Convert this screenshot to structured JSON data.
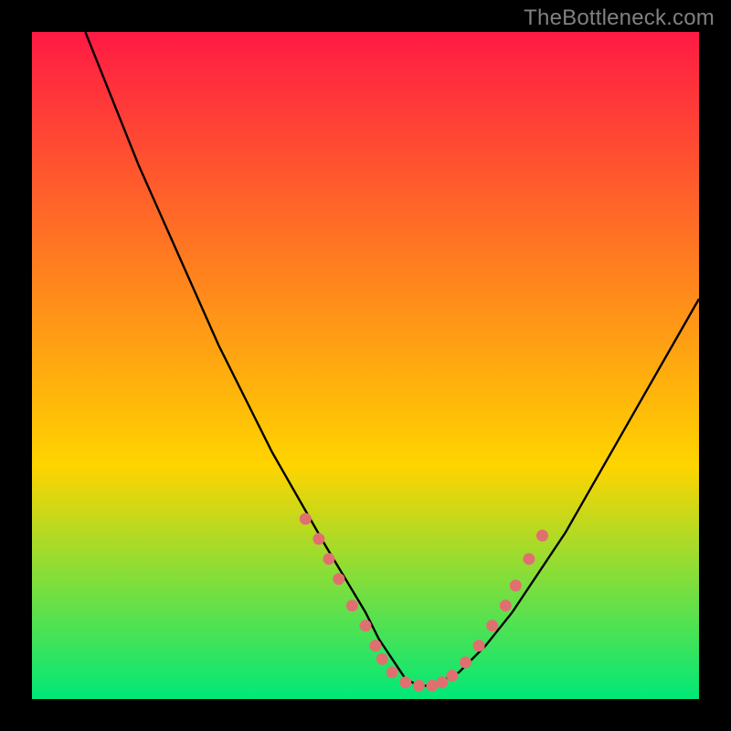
{
  "watermark": {
    "text": "TheBottleneck.com"
  },
  "colors": {
    "frame_bg": "#000000",
    "gradient_top": "#ff1a44",
    "gradient_mid": "#ffd400",
    "gradient_bottom": "#00e878",
    "curve": "#000000",
    "dots": "#e07070"
  },
  "chart_data": {
    "type": "line",
    "title": "",
    "xlabel": "",
    "ylabel": "",
    "xlim": [
      0,
      100
    ],
    "ylim": [
      0,
      100
    ],
    "grid": false,
    "series": [
      {
        "name": "bottleneck_curve",
        "x": [
          8,
          12,
          16,
          20,
          24,
          28,
          32,
          36,
          40,
          44,
          47,
          50,
          52,
          54,
          56,
          58,
          60,
          64,
          68,
          72,
          76,
          80,
          84,
          88,
          92,
          96,
          100
        ],
        "y": [
          100,
          90,
          80,
          71,
          62,
          53,
          45,
          37,
          30,
          23,
          18,
          13,
          9,
          6,
          3,
          2,
          2,
          4,
          8,
          13,
          19,
          25,
          32,
          39,
          46,
          53,
          60
        ]
      }
    ],
    "annotations": {
      "highlight_dots": [
        {
          "x": 41,
          "y": 27
        },
        {
          "x": 43,
          "y": 24
        },
        {
          "x": 44.5,
          "y": 21
        },
        {
          "x": 46,
          "y": 18
        },
        {
          "x": 48,
          "y": 14
        },
        {
          "x": 50,
          "y": 11
        },
        {
          "x": 51.5,
          "y": 8
        },
        {
          "x": 52.5,
          "y": 6
        },
        {
          "x": 54,
          "y": 4
        },
        {
          "x": 56,
          "y": 2.5
        },
        {
          "x": 58,
          "y": 2
        },
        {
          "x": 60,
          "y": 2
        },
        {
          "x": 61.5,
          "y": 2.5
        },
        {
          "x": 63,
          "y": 3.5
        },
        {
          "x": 65,
          "y": 5.5
        },
        {
          "x": 67,
          "y": 8
        },
        {
          "x": 69,
          "y": 11
        },
        {
          "x": 71,
          "y": 14
        },
        {
          "x": 72.5,
          "y": 17
        },
        {
          "x": 74.5,
          "y": 21
        },
        {
          "x": 76.5,
          "y": 24.5
        }
      ]
    }
  }
}
